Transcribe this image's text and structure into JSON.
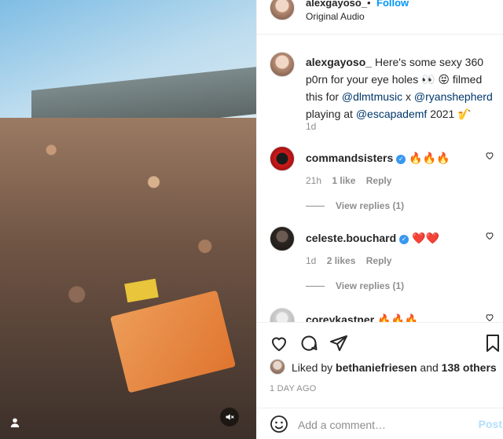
{
  "header": {
    "username": "alexgayoso_",
    "dot": "•",
    "follow_label": "Follow",
    "subtitle": "Original Audio"
  },
  "caption": {
    "username": "alexgayoso_",
    "text_part1": " Here's some sexy 360 p0rn for your eye holes 👀 😝 filmed this for ",
    "mention1": "@dlmtmusic",
    "text_part2": " x ",
    "mention2": "@ryanshepherd",
    "text_part3": " playing at ",
    "mention3": "@escapademf",
    "text_part4": " 2021 🎷",
    "time": "1d"
  },
  "comments": [
    {
      "username": "commandsisters",
      "text": "🔥🔥🔥",
      "time": "21h",
      "likes": "1 like",
      "reply_label": "Reply",
      "view_replies": "View replies (1)"
    },
    {
      "username": "celeste.bouchard",
      "text": "❤️❤️",
      "time": "1d",
      "likes": "2 likes",
      "reply_label": "Reply",
      "view_replies": "View replies (1)"
    },
    {
      "username": "coreykastner",
      "text": "🔥🔥🔥"
    }
  ],
  "likes": {
    "prefix": "Liked by ",
    "user": "bethaniefriesen",
    "middle": " and ",
    "others": "138 others"
  },
  "posted_ago": "1 DAY AGO",
  "add_comment": {
    "placeholder": "Add a comment…",
    "post_label": "Post"
  },
  "icons": {
    "like": "heart-icon",
    "comment": "comment-bubble-icon",
    "share": "paper-plane-icon",
    "save": "bookmark-icon",
    "emoji": "emoji-smile-icon",
    "mute": "speaker-muted-icon",
    "user_tag": "person-icon"
  },
  "colors": {
    "link_blue": "#0095f6",
    "mention": "#00376b",
    "verified": "#3897f0",
    "post_disabled": "#b2dffc"
  }
}
